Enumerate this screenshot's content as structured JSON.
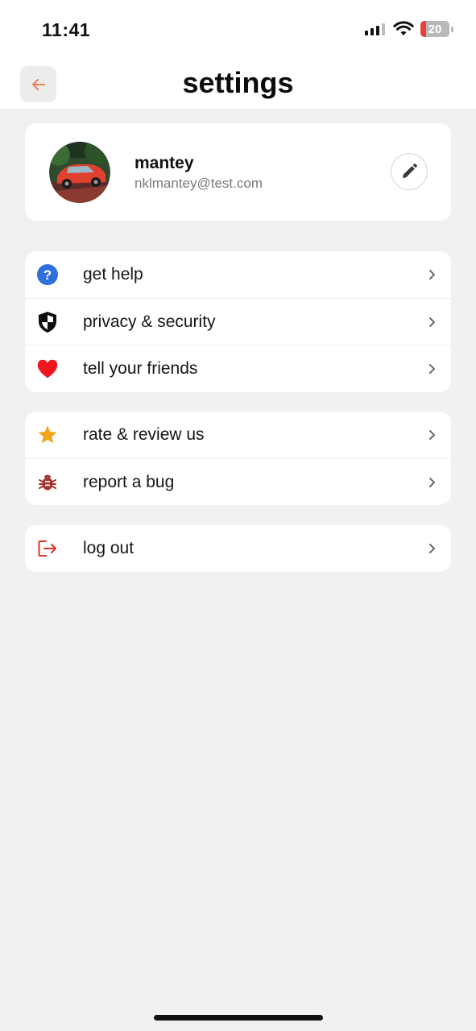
{
  "status_bar": {
    "time": "11:41",
    "battery_level": "20"
  },
  "header": {
    "title": "settings"
  },
  "profile": {
    "name": "mantey",
    "email": "nklmantey@test.com"
  },
  "menu_groups": [
    {
      "items": [
        {
          "label": "get help",
          "icon": "question-circle-icon"
        },
        {
          "label": "privacy & security",
          "icon": "shield-icon"
        },
        {
          "label": "tell your friends",
          "icon": "heart-icon"
        }
      ]
    },
    {
      "items": [
        {
          "label": "rate & review us",
          "icon": "star-icon"
        },
        {
          "label": "report a bug",
          "icon": "bug-icon"
        }
      ]
    },
    {
      "items": [
        {
          "label": "log out",
          "icon": "logout-icon"
        }
      ]
    }
  ],
  "colors": {
    "accent": "#f07b4f",
    "help_icon": "#2f6fdc",
    "heart_icon": "#f0151f",
    "star_icon": "#f5a31a",
    "bug_icon": "#a8312f",
    "logout_icon": "#e0312b"
  }
}
